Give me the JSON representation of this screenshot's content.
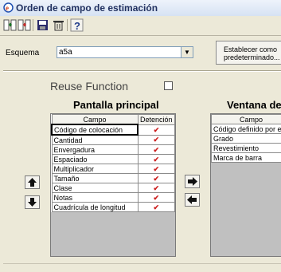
{
  "window": {
    "title": "Orden de campo de estimación"
  },
  "toolbar": {
    "icons": [
      "merge-icon",
      "merge-red-icon",
      "save-icon",
      "delete-icon",
      "help-icon"
    ],
    "help_label": "?"
  },
  "esquema": {
    "label": "Esquema",
    "value": "a5a",
    "button_line1": "Establecer como",
    "button_line2": "predeterminado..."
  },
  "reuse": {
    "label": "Reuse Function",
    "checked": false
  },
  "pantalla": {
    "title": "Pantalla principal",
    "columns": [
      "Campo",
      "Detención"
    ],
    "rows": [
      {
        "campo": "Código de colocación",
        "det": "✔"
      },
      {
        "campo": "Cantidad",
        "det": "✔"
      },
      {
        "campo": "Envergadura",
        "det": "✔"
      },
      {
        "campo": "Espaciado",
        "det": "✔"
      },
      {
        "campo": "Multiplicador",
        "det": "✔"
      },
      {
        "campo": "Tamaño",
        "det": "✔"
      },
      {
        "campo": "Clase",
        "det": "✔"
      },
      {
        "campo": "Notas",
        "det": "✔"
      },
      {
        "campo": "Cuadrícula de longitud",
        "det": "✔"
      }
    ]
  },
  "ventana": {
    "title": "Ventana de c",
    "columns": [
      "Campo"
    ],
    "rows": [
      {
        "campo": "Código definido por el u"
      },
      {
        "campo": "Grado"
      },
      {
        "campo": "Revestimiento"
      },
      {
        "campo": "Marca de barra"
      }
    ]
  },
  "colors": {
    "checkmark": "#cc2020",
    "title_text": "#203060"
  }
}
